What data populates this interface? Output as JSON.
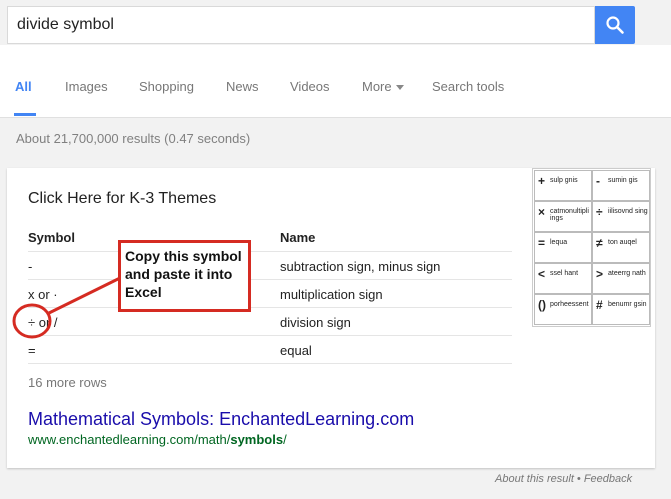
{
  "search": {
    "query": "divide symbol"
  },
  "tabs": [
    {
      "label": "All"
    },
    {
      "label": "Images"
    },
    {
      "label": "Shopping"
    },
    {
      "label": "News"
    },
    {
      "label": "Videos"
    },
    {
      "label": "More"
    },
    {
      "label": "Search tools"
    }
  ],
  "results_stats": "About 21,700,000 results (0.47 seconds)",
  "card": {
    "heading": "Click Here for K-3 Themes",
    "columns": [
      "Symbol",
      "Name"
    ],
    "rows": [
      {
        "symbol": "-",
        "name": "subtraction sign, minus sign"
      },
      {
        "symbol": "x or ·",
        "name": "multiplication sign"
      },
      {
        "symbol": "÷ or /",
        "name": "division sign"
      },
      {
        "symbol": "=",
        "name": "equal"
      }
    ],
    "more_rows": "16 more rows",
    "link_title": "Mathematical Symbols: EnchantedLearning.com",
    "link_url_prefix": "www.enchantedlearning.com/math/",
    "link_url_bold": "symbols",
    "link_url_suffix": "/"
  },
  "thumbnail": {
    "cells": [
      {
        "sym": "+",
        "text": "sulp gnis"
      },
      {
        "sym": "-",
        "text": "sumin gis"
      },
      {
        "sym": "×",
        "text": "catmonultipli ings"
      },
      {
        "sym": "÷",
        "text": "iilisovnd sing"
      },
      {
        "sym": "=",
        "text": "lequa"
      },
      {
        "sym": "≠",
        "text": "ton auqel"
      },
      {
        "sym": "<",
        "text": "ssel hant"
      },
      {
        "sym": ">",
        "text": "ateerrg nath"
      },
      {
        "sym": "()",
        "text": "porheessent"
      },
      {
        "sym": "#",
        "text": "benumr gsin"
      }
    ]
  },
  "annotation": {
    "text": "Copy this symbol and paste it into Excel",
    "color": "#d52b22"
  },
  "footer": "About this result • Feedback",
  "colors": {
    "accent": "#4285f4",
    "link": "#1a0dab",
    "url": "#006621"
  }
}
